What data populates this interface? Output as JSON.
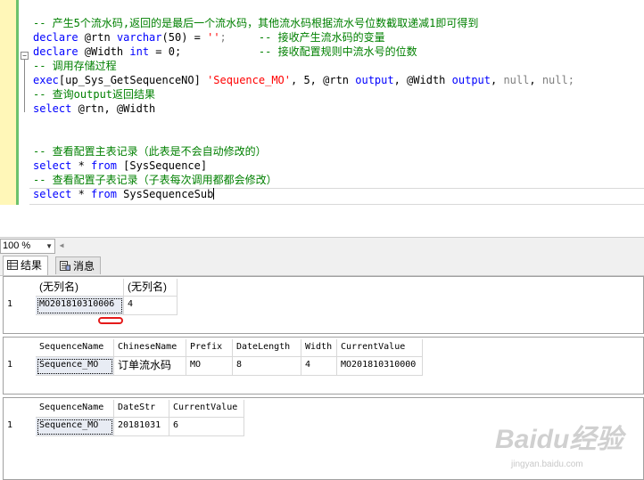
{
  "editor": {
    "lines": [
      [
        {
          "t": "-- 产生5个流水码,返回的是最后一个流水码，其他流水码根据流水号位数截取递减1即可得到",
          "c": "cm"
        }
      ],
      [
        {
          "t": "declare",
          "c": "kw"
        },
        {
          "t": " @rtn ",
          "c": ""
        },
        {
          "t": "varchar",
          "c": "kw"
        },
        {
          "t": "(50) = ",
          "c": ""
        },
        {
          "t": "''",
          "c": "str"
        },
        {
          "t": ";",
          "c": "gy"
        },
        {
          "t": "     ",
          "c": ""
        },
        {
          "t": "-- 接收产生流水码的变量",
          "c": "cm"
        }
      ],
      [
        {
          "t": "declare",
          "c": "kw"
        },
        {
          "t": " @Width ",
          "c": ""
        },
        {
          "t": "int",
          "c": "kw"
        },
        {
          "t": " = 0;",
          "c": ""
        },
        {
          "t": "            ",
          "c": ""
        },
        {
          "t": "-- 接收配置规则中流水号的位数",
          "c": "cm"
        }
      ],
      [
        {
          "t": "-- 调用存储过程",
          "c": "cm"
        }
      ],
      [
        {
          "t": "exec",
          "c": "kw"
        },
        {
          "t": "[up_Sys_GetSequenceNO] ",
          "c": ""
        },
        {
          "t": "'Sequence_MO'",
          "c": "str"
        },
        {
          "t": ", 5, @rtn ",
          "c": ""
        },
        {
          "t": "output",
          "c": "kw"
        },
        {
          "t": ", @Width ",
          "c": ""
        },
        {
          "t": "output",
          "c": "kw"
        },
        {
          "t": ", ",
          "c": ""
        },
        {
          "t": "null",
          "c": "gy"
        },
        {
          "t": ", ",
          "c": ""
        },
        {
          "t": "null",
          "c": "gy"
        },
        {
          "t": ";",
          "c": "gy"
        }
      ],
      [
        {
          "t": "-- 查询output返回结果",
          "c": "cm"
        }
      ],
      [
        {
          "t": "select",
          "c": "kw"
        },
        {
          "t": " @rtn, @Width",
          "c": ""
        }
      ],
      [
        {
          "t": "",
          "c": ""
        }
      ],
      [
        {
          "t": "",
          "c": ""
        }
      ],
      [
        {
          "t": "-- 查看配置主表记录（此表是不会自动修改的）",
          "c": "cm"
        }
      ],
      [
        {
          "t": "select",
          "c": "kw"
        },
        {
          "t": " * ",
          "c": ""
        },
        {
          "t": "from",
          "c": "kw"
        },
        {
          "t": " [SysSequence]",
          "c": ""
        }
      ],
      [
        {
          "t": "-- 查看配置子表记录（子表每次调用都都会修改）",
          "c": "cm"
        }
      ],
      [
        {
          "t": "select",
          "c": "kw"
        },
        {
          "t": " * ",
          "c": ""
        },
        {
          "t": "from",
          "c": "kw"
        },
        {
          "t": " SysSequenceSub",
          "c": ""
        }
      ]
    ]
  },
  "zoom": {
    "value": "100 %"
  },
  "tabs": {
    "results": "结果",
    "messages": "消息"
  },
  "grid1": {
    "headers": [
      "(无列名)",
      "(无列名)"
    ],
    "rows": [
      [
        "1",
        "MO201810310006",
        "4"
      ]
    ]
  },
  "grid2": {
    "headers": [
      "SequenceName",
      "ChineseName",
      "Prefix",
      "DateLength",
      "Width",
      "CurrentValue"
    ],
    "rows": [
      [
        "1",
        "Sequence_MO",
        "订单流水码",
        "MO",
        "8",
        "4",
        "MO201810310000"
      ]
    ]
  },
  "grid3": {
    "headers": [
      "SequenceName",
      "DateStr",
      "CurrentValue"
    ],
    "rows": [
      [
        "1",
        "Sequence_MO",
        "20181031",
        "6"
      ]
    ]
  },
  "watermark": {
    "logo": "Baidu经验",
    "url": "jingyan.baidu.com"
  },
  "colors": {
    "keyword": "#0000ff",
    "comment": "#008000",
    "string": "#ff0000",
    "highlight": "#e41a1a"
  },
  "icons": [
    "grid-results-icon",
    "messages-icon",
    "chevron-down-icon"
  ]
}
